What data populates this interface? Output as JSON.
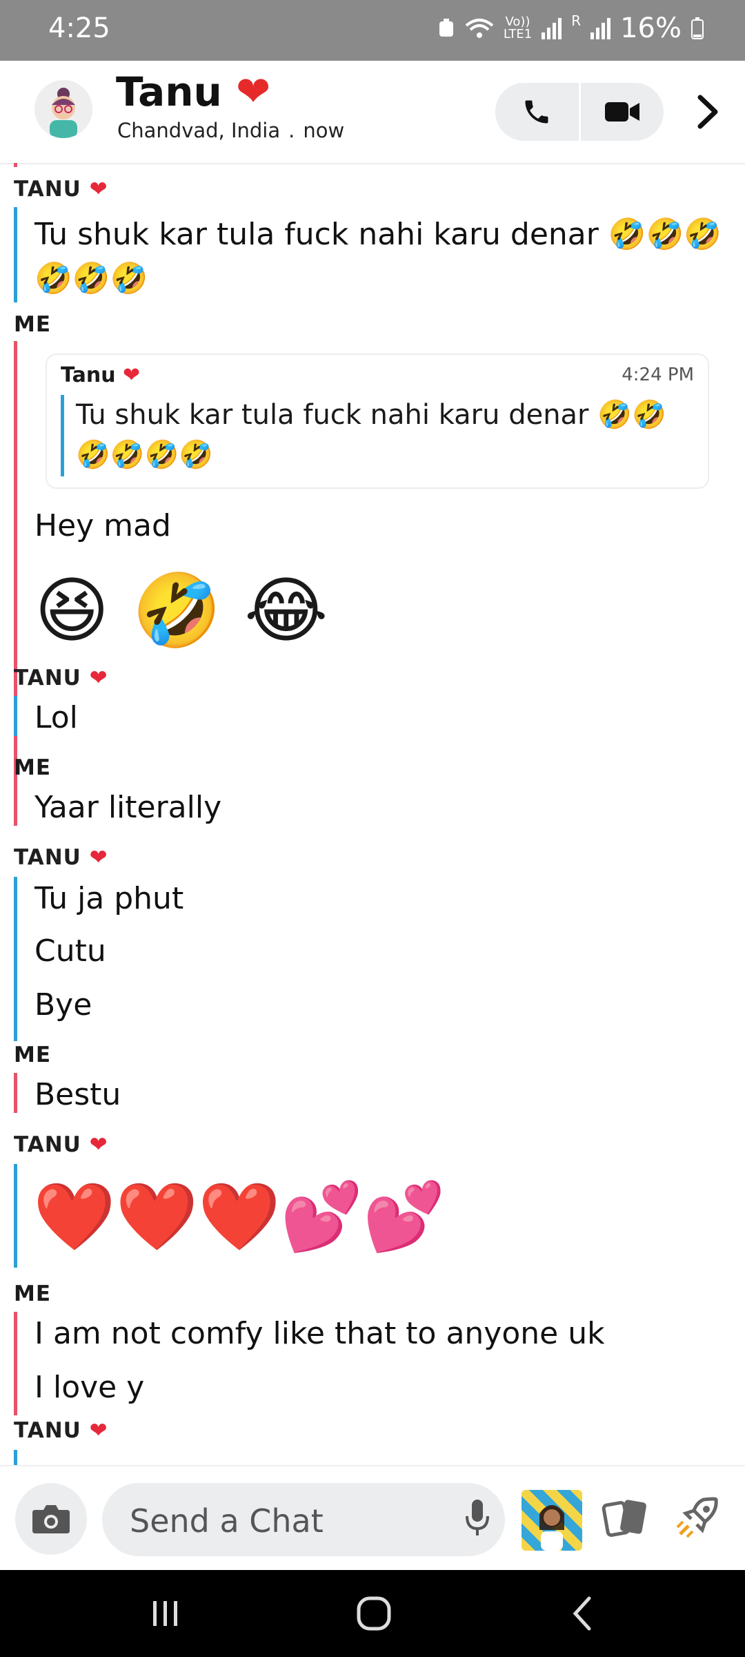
{
  "status_bar": {
    "time": "4:25",
    "network_top": "Vo))",
    "network_bottom": "LTE1",
    "roaming": "R",
    "battery": "16%"
  },
  "header": {
    "contact_name": "Tanu",
    "name_heart": "❤",
    "location": "Chandvad, India",
    "separator": ".",
    "last_seen": "now"
  },
  "messages": {
    "tanu_label": "TANU",
    "me_label": "ME",
    "heart": "❤",
    "m1_text": "Tu shuk kar tula fuck nahi karu denar 🤣🤣🤣🤣🤣🤣",
    "quote": {
      "name": "Tanu",
      "time": "4:24 PM",
      "text": "Tu shuk kar tula fuck nahi karu denar 🤣🤣🤣🤣🤣🤣"
    },
    "m2_text": "Hey mad",
    "m2_emojis": "😆 🤣 😂",
    "m3_text": "Lol",
    "m4_text": "Yaar literally",
    "m5_text": "Tu ja phut",
    "m6_text": "Cutu",
    "m7_text": "Bye",
    "m8_text": "Bestu",
    "m9_emojis": "❤️❤️❤️💕💕",
    "m10_text": "I am not comfy like that to anyone uk",
    "m11_text": "I love y"
  },
  "composer": {
    "placeholder": "Send a Chat"
  },
  "icons": {
    "camera": "camera-icon",
    "mic": "microphone-icon",
    "cards": "cards-icon",
    "rocket": "rocket-icon"
  },
  "colors": {
    "tanu_bar": "#2a9fd8",
    "me_bar": "#e8526a",
    "heart": "#e6283a"
  }
}
